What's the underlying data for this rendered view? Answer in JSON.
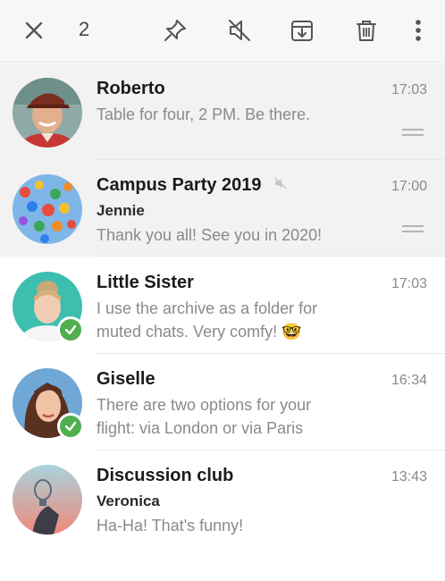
{
  "toolbar": {
    "selected_count": "2",
    "icons": [
      "close-icon",
      "pin-icon",
      "mute-icon",
      "archive-icon",
      "delete-icon",
      "more-icon"
    ]
  },
  "chats": [
    {
      "name": "Roberto",
      "time": "17:03",
      "message": "Table for four, 2 PM. Be there.",
      "pinned": true,
      "selected": true
    },
    {
      "name": "Campus Party 2019",
      "muted": true,
      "sender": "Jennie",
      "time": "17:00",
      "message": "Thank you all! See you in 2020!",
      "pinned": true,
      "selected": true
    },
    {
      "name": "Little Sister",
      "time": "17:03",
      "message_line1": "I use the archive as a folder for",
      "message_line2": "muted chats. Very comfy! 🤓",
      "online_check": true
    },
    {
      "name": "Giselle",
      "time": "16:34",
      "message_line1": "There are two options for your",
      "message_line2": "flight: via London or via Paris",
      "online_check": true
    },
    {
      "name": "Discussion club",
      "sender": "Veronica",
      "time": "13:43",
      "message": "Ha-Ha! That's funny!"
    }
  ],
  "colors": {
    "check_green": "#4fae4e",
    "selected_bg": "#f2f2f2",
    "toolbar_bg": "#f7f7f7",
    "muted_text": "#8a8a8a"
  }
}
